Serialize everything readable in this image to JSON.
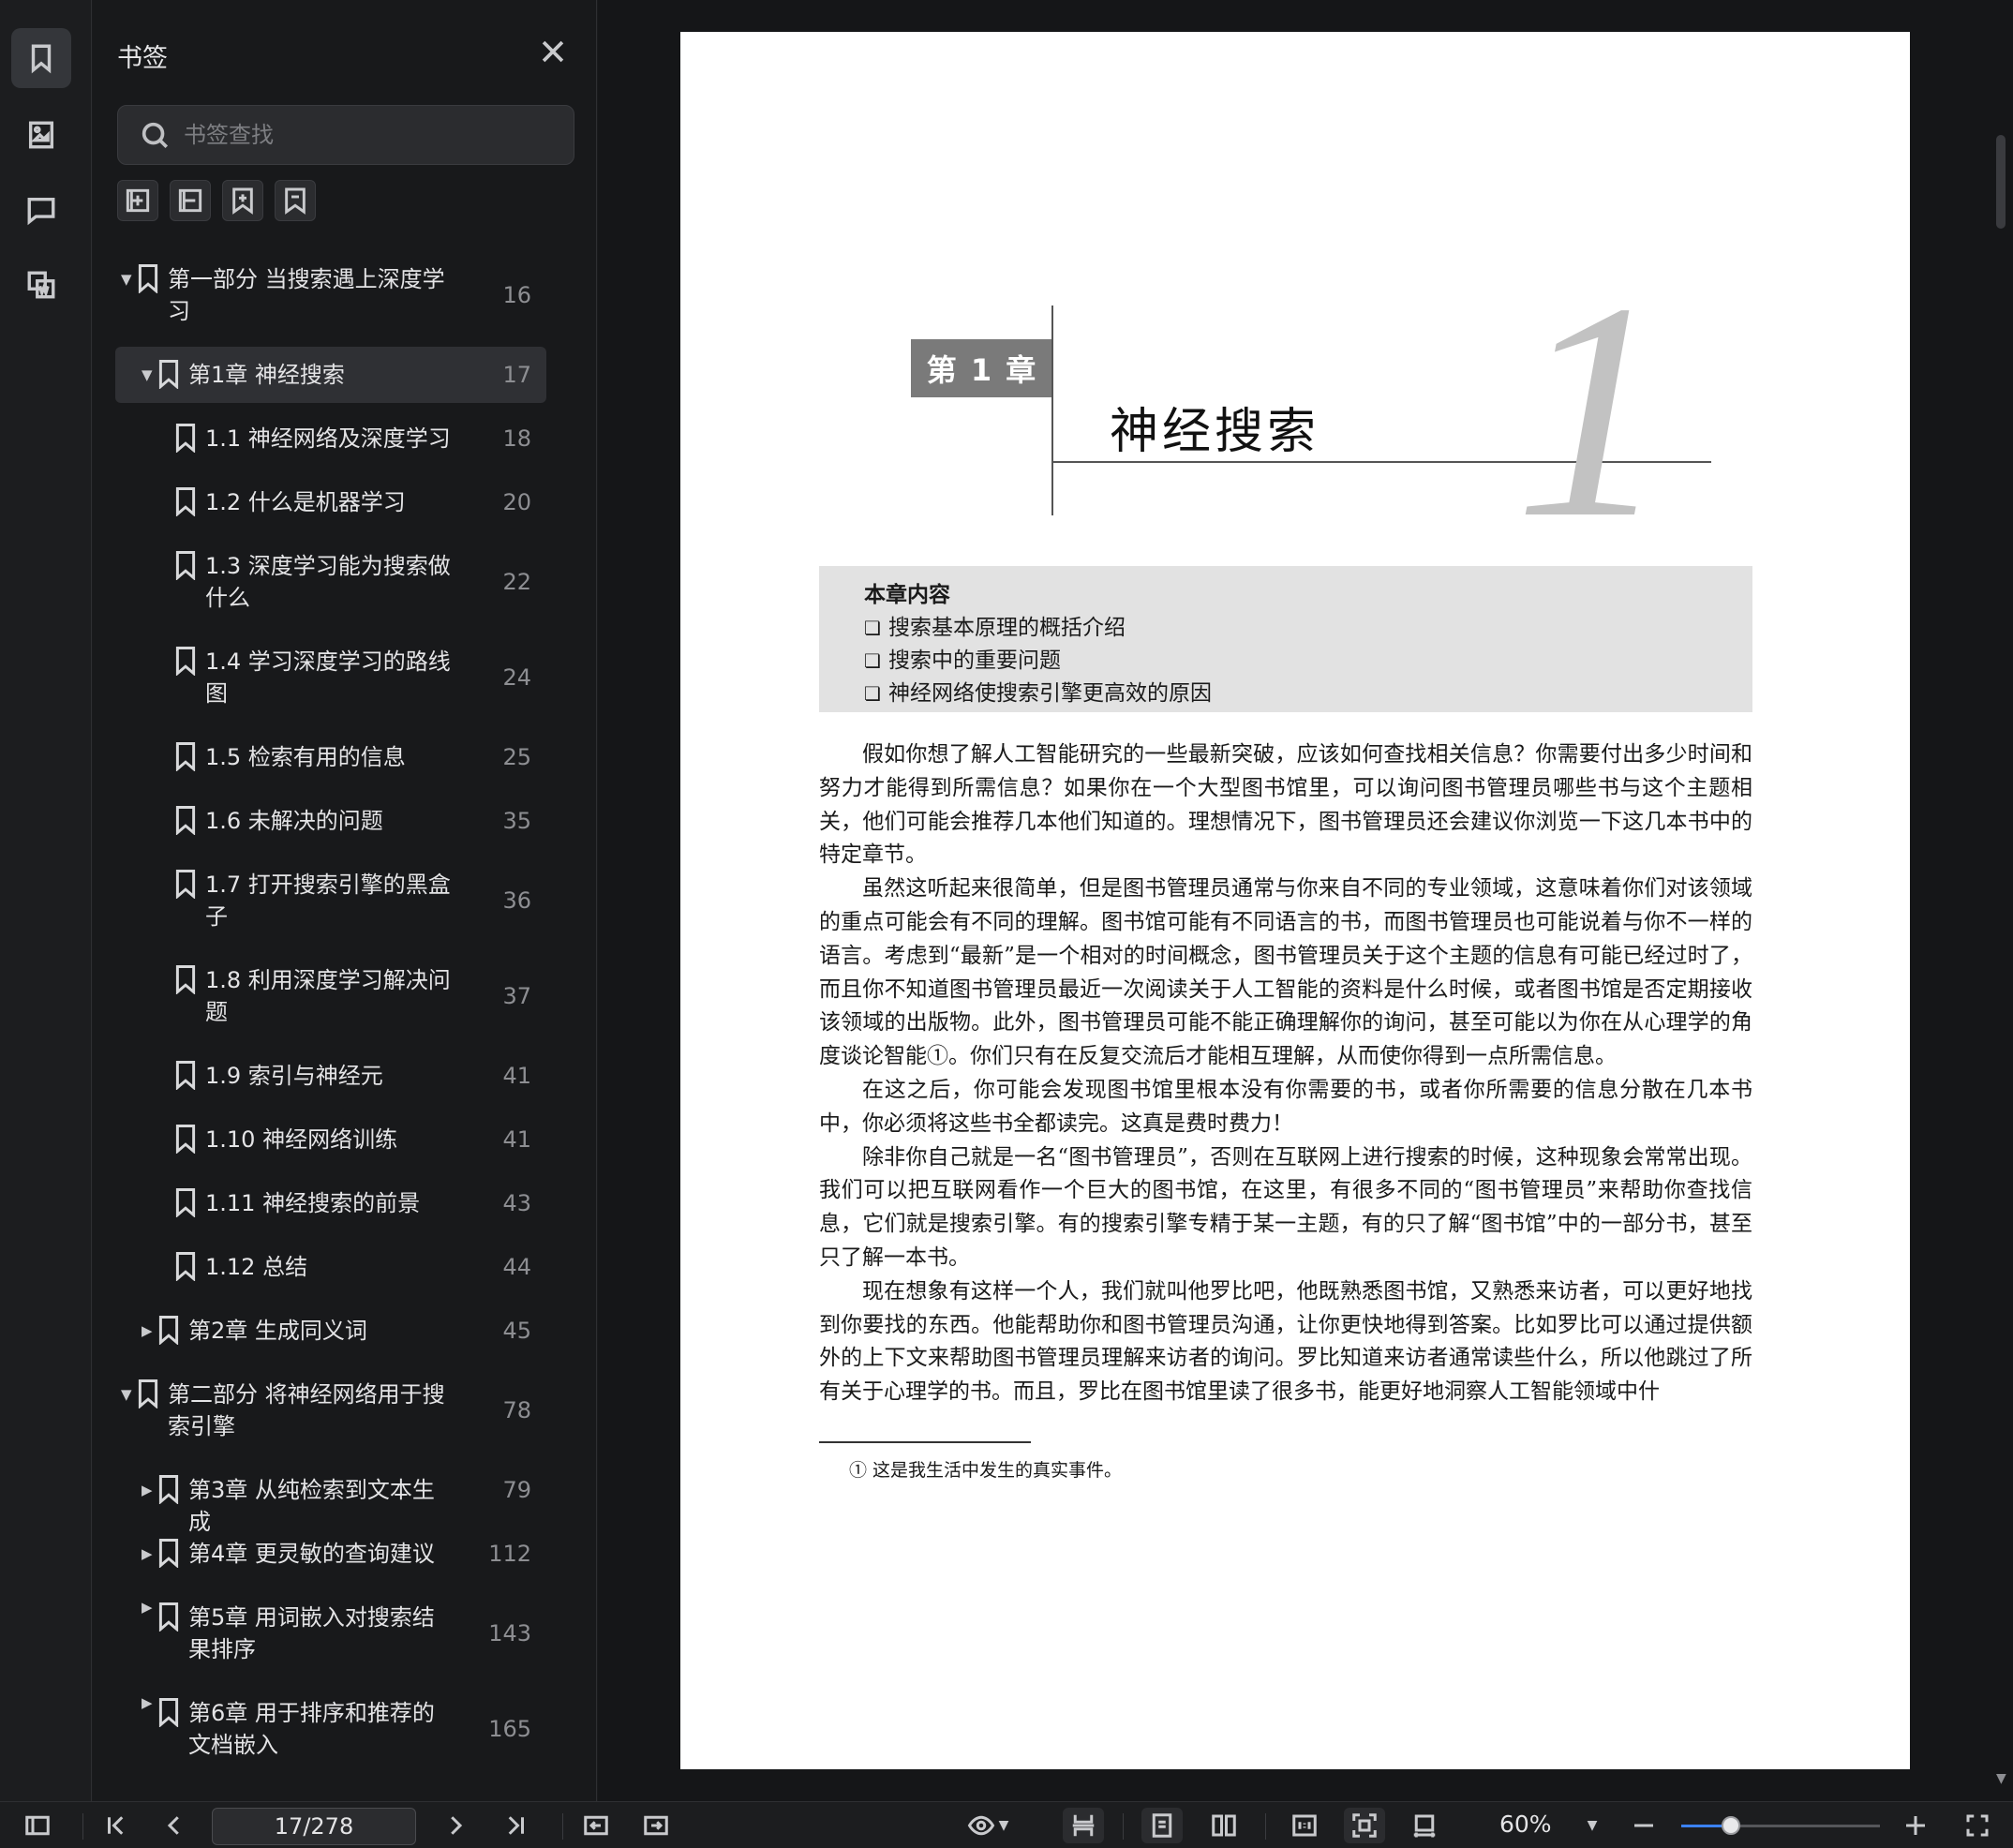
{
  "sidebar": {
    "title": "书签",
    "search_placeholder": "书签查找",
    "rail_icons": [
      "bookmark-icon",
      "image-icon",
      "comment-icon",
      "word-convert-icon"
    ],
    "tools": [
      "expand-all-icon",
      "collapse-all-icon",
      "add-bookmark-icon",
      "bookmark-outline-icon"
    ],
    "items": [
      {
        "label": "第一部分 当搜索遇上深度学习",
        "page": "16",
        "level": 0,
        "expanded": true
      },
      {
        "label": "第1章 神经搜索",
        "page": "17",
        "level": 1,
        "expanded": true,
        "selected": true
      },
      {
        "label": "1.1 神经网络及深度学习",
        "page": "18",
        "level": 2
      },
      {
        "label": "1.2 什么是机器学习",
        "page": "20",
        "level": 2
      },
      {
        "label": "1.3 深度学习能为搜索做什么",
        "page": "22",
        "level": 2
      },
      {
        "label": "1.4 学习深度学习的路线图",
        "page": "24",
        "level": 2
      },
      {
        "label": "1.5 检索有用的信息",
        "page": "25",
        "level": 2
      },
      {
        "label": "1.6 未解决的问题",
        "page": "35",
        "level": 2
      },
      {
        "label": "1.7 打开搜索引擎的黑盒子",
        "page": "36",
        "level": 2
      },
      {
        "label": "1.8 利用深度学习解决问题",
        "page": "37",
        "level": 2
      },
      {
        "label": "1.9 索引与神经元",
        "page": "41",
        "level": 2
      },
      {
        "label": "1.10 神经网络训练",
        "page": "41",
        "level": 2
      },
      {
        "label": "1.11 神经搜索的前景",
        "page": "43",
        "level": 2
      },
      {
        "label": "1.12 总结",
        "page": "44",
        "level": 2
      },
      {
        "label": "第2章 生成同义词",
        "page": "45",
        "level": 1,
        "expanded": false
      },
      {
        "label": "第二部分 将神经网络用于搜索引擎",
        "page": "78",
        "level": 0,
        "expanded": true
      },
      {
        "label": "第3章 从纯检索到文本生成",
        "page": "79",
        "level": 1,
        "expanded": false
      },
      {
        "label": "第4章 更灵敏的查询建议",
        "page": "112",
        "level": 1,
        "expanded": false
      },
      {
        "label": "第5章 用词嵌入对搜索结果排序",
        "page": "143",
        "level": 1,
        "expanded": false
      },
      {
        "label": "第6章 用于排序和推荐的文档嵌入",
        "page": "165",
        "level": 1,
        "expanded": false
      }
    ]
  },
  "document": {
    "chapter_label": "第 1 章",
    "chapter_title": "神经搜索",
    "chapter_number": "1",
    "summary_head": "本章内容",
    "summary_items": [
      "搜索基本原理的概括介绍",
      "搜索中的重要问题",
      "神经网络使搜索引擎更高效的原因"
    ],
    "paragraphs": [
      "假如你想了解人工智能研究的一些最新突破，应该如何查找相关信息？你需要付出多少时间和努力才能得到所需信息？如果你在一个大型图书馆里，可以询问图书管理员哪些书与这个主题相关，他们可能会推荐几本他们知道的。理想情况下，图书管理员还会建议你浏览一下这几本书中的特定章节。",
      "虽然这听起来很简单，但是图书管理员通常与你来自不同的专业领域，这意味着你们对该领域的重点可能会有不同的理解。图书馆可能有不同语言的书，而图书管理员也可能说着与你不一样的语言。考虑到“最新”是一个相对的时间概念，图书管理员关于这个主题的信息有可能已经过时了，而且你不知道图书管理员最近一次阅读关于人工智能的资料是什么时候，或者图书馆是否定期接收该领域的出版物。此外，图书管理员可能不能正确理解你的询问，甚至可能以为你在从心理学的角度谈论智能①。你们只有在反复交流后才能相互理解，从而使你得到一点所需信息。",
      "在这之后，你可能会发现图书馆里根本没有你需要的书，或者你所需要的信息分散在几本书中，你必须将这些书全都读完。这真是费时费力！",
      "除非你自己就是一名“图书管理员”，否则在互联网上进行搜索的时候，这种现象会常常出现。我们可以把互联网看作一个巨大的图书馆，在这里，有很多不同的“图书管理员”来帮助你查找信息，它们就是搜索引擎。有的搜索引擎专精于某一主题，有的只了解“图书馆”中的一部分书，甚至只了解一本书。",
      "现在想象有这样一个人，我们就叫他罗比吧，他既熟悉图书馆，又熟悉来访者，可以更好地找到你要找的东西。他能帮助你和图书管理员沟通，让你更快地得到答案。比如罗比可以通过提供额外的上下文来帮助图书管理员理解来访者的询问。罗比知道来访者通常读些什么，所以他跳过了所有关于心理学的书。而且，罗比在图书馆里读了很多书，能更好地洞察人工智能领域中什"
    ],
    "footnote": "① 这是我生活中发生的真实事件。"
  },
  "toolbar": {
    "page_value": "17/278",
    "zoom": "60%",
    "zoom_fraction": 0.25
  }
}
